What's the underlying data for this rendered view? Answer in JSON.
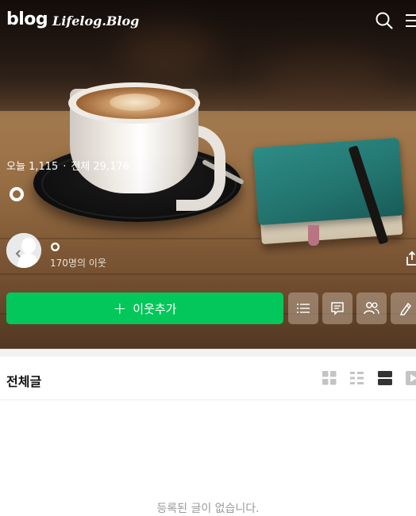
{
  "header": {
    "logo": "blog",
    "blog_name": "Lifelog.Blog",
    "search_icon": "search-icon",
    "menu_icon": "hamburger-menu-icon"
  },
  "profile": {
    "visits_today_label": "오늘",
    "visits_today": "1,115",
    "visits_total_label": "전체",
    "visits_total": "29,176",
    "blog_title_icon": "circle-icon",
    "nickname_icon": "circle-icon",
    "neighbors": "170명의 이웃",
    "avatar_icon": "default-avatar-icon",
    "share_icon": "share-icon"
  },
  "actions": {
    "add_neighbor_icon": "plus-icon",
    "add_neighbor_label": "이웃추가",
    "buttons": [
      "list-icon",
      "comment-icon",
      "people-icon",
      "edit-icon"
    ]
  },
  "posts": {
    "section_title": "전체글",
    "view_modes": [
      "grid-view-icon",
      "compact-list-icon",
      "card-view-icon",
      "video-view-icon"
    ],
    "active_view": "card-view-icon",
    "empty_message": "등록된 글이 없습니다."
  },
  "colors": {
    "accent": "#03c75a",
    "text_dark": "#111111",
    "text_muted": "#9a9a9a"
  }
}
